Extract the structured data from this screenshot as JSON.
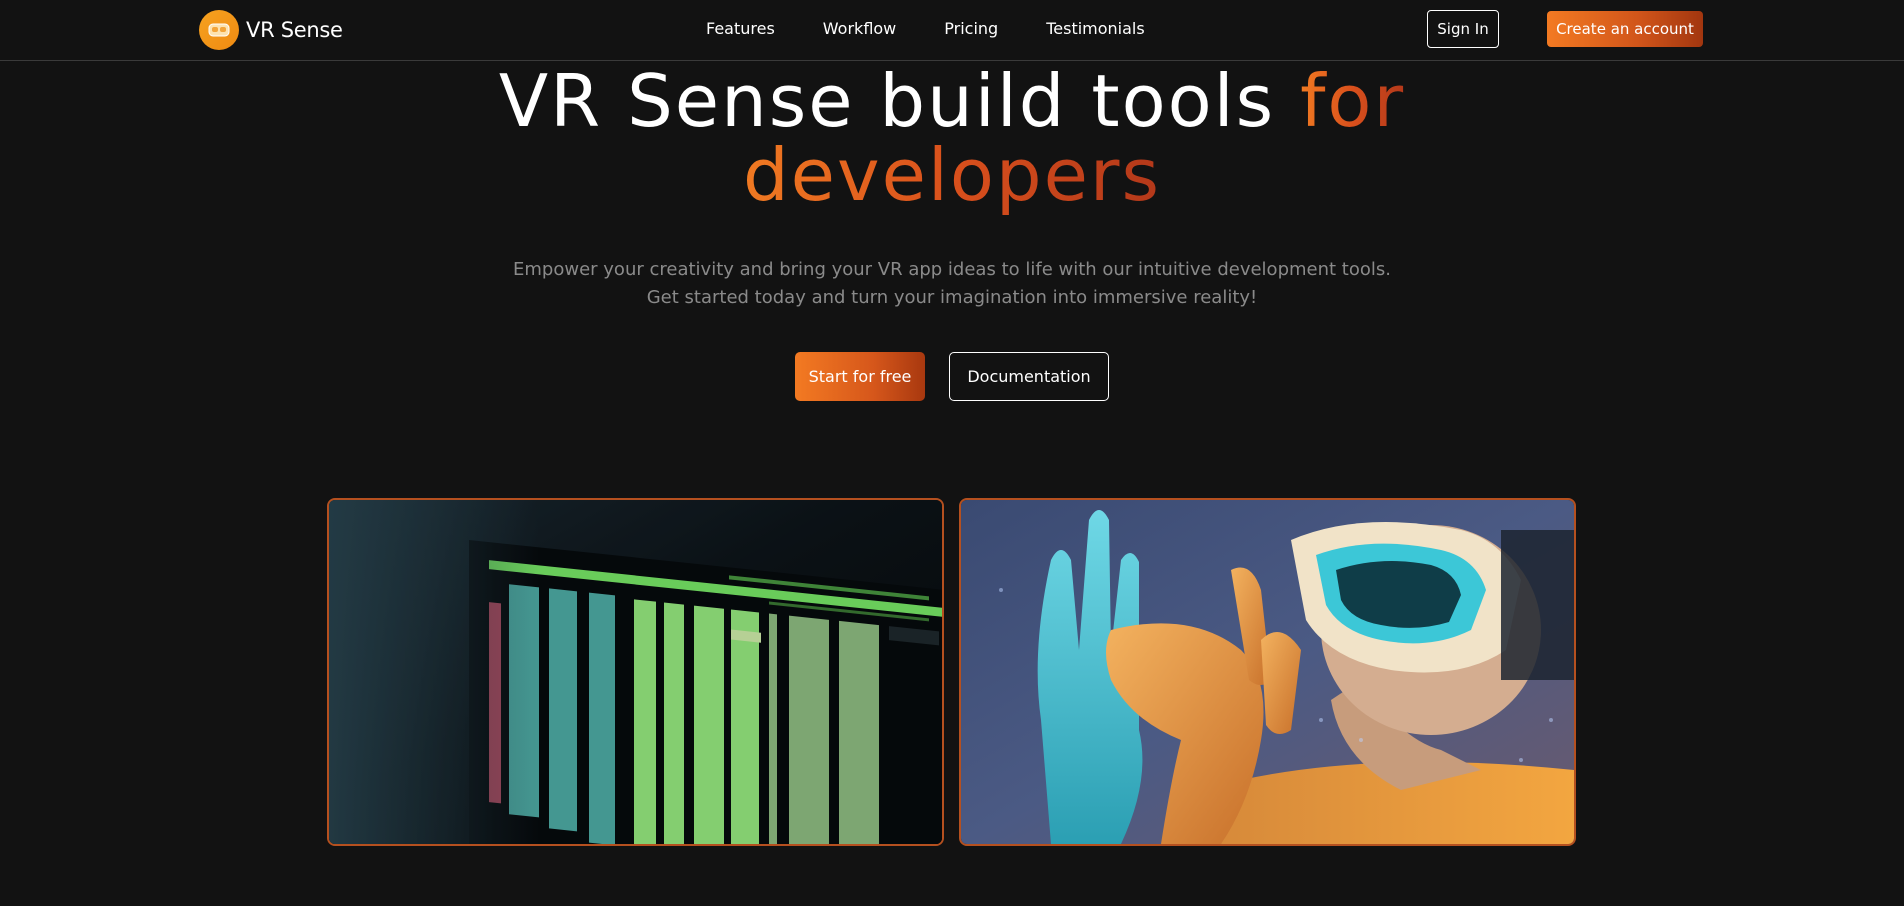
{
  "brand": {
    "name": "VR Sense"
  },
  "nav": {
    "links": [
      "Features",
      "Workflow",
      "Pricing",
      "Testimonials"
    ],
    "sign_in": "Sign In",
    "create_account": "Create an account"
  },
  "hero": {
    "title_main": "VR Sense build tools ",
    "title_accent_1": "for",
    "title_accent_2": "developers",
    "subtitle_line1": "Empower your creativity and bring your VR app ideas to life with our intuitive development tools.",
    "subtitle_line2": "Get started today and turn your imagination into immersive reality!",
    "cta_primary": "Start for free",
    "cta_secondary": "Documentation"
  },
  "colors": {
    "background": "#121212",
    "accent_start": "#f37a22",
    "accent_end": "#a2360f",
    "card_border": "#b5501f",
    "subtitle": "#8a8a8a"
  },
  "images": [
    {
      "depicts": "terminal-code-screen"
    },
    {
      "depicts": "person-wearing-vr-headset"
    }
  ]
}
